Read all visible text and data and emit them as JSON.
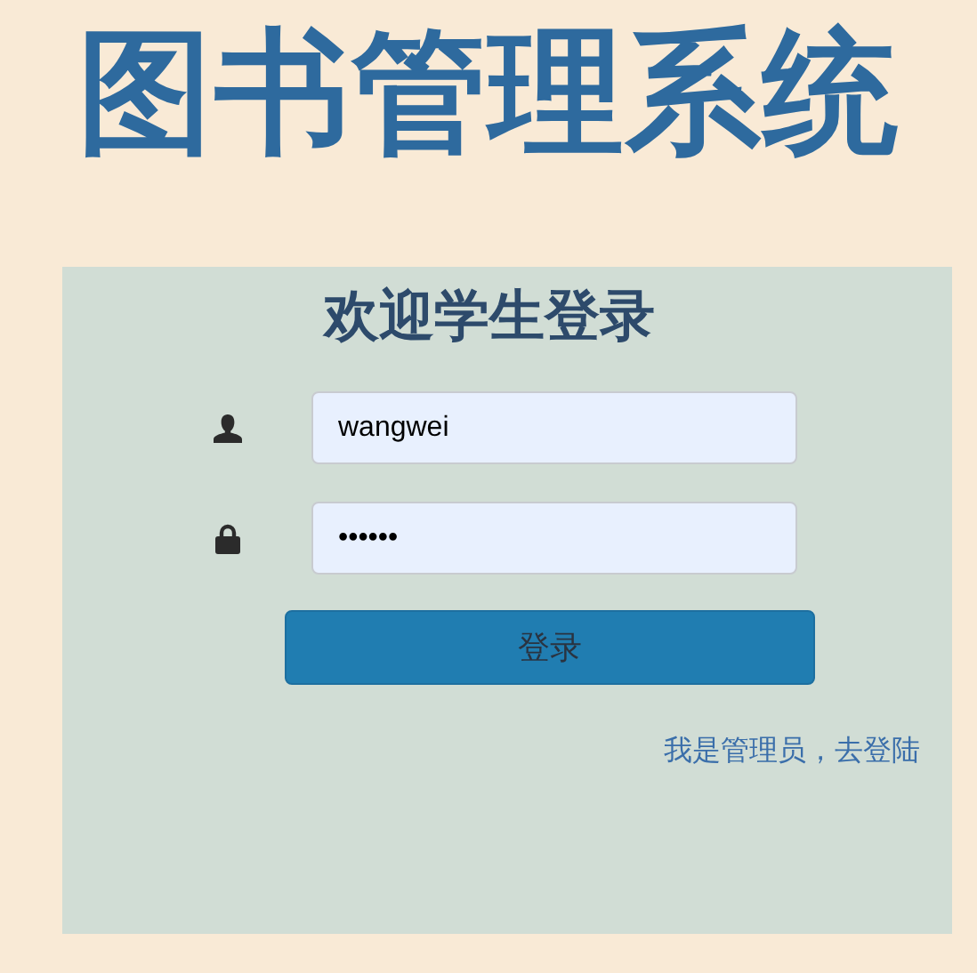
{
  "app_title": "图书管理系统",
  "login": {
    "heading": "欢迎学生登录",
    "username": {
      "value": "wangwei"
    },
    "password": {
      "value": "••••••"
    },
    "submit": "登录",
    "admin_link": "我是管理员，去登陆"
  }
}
